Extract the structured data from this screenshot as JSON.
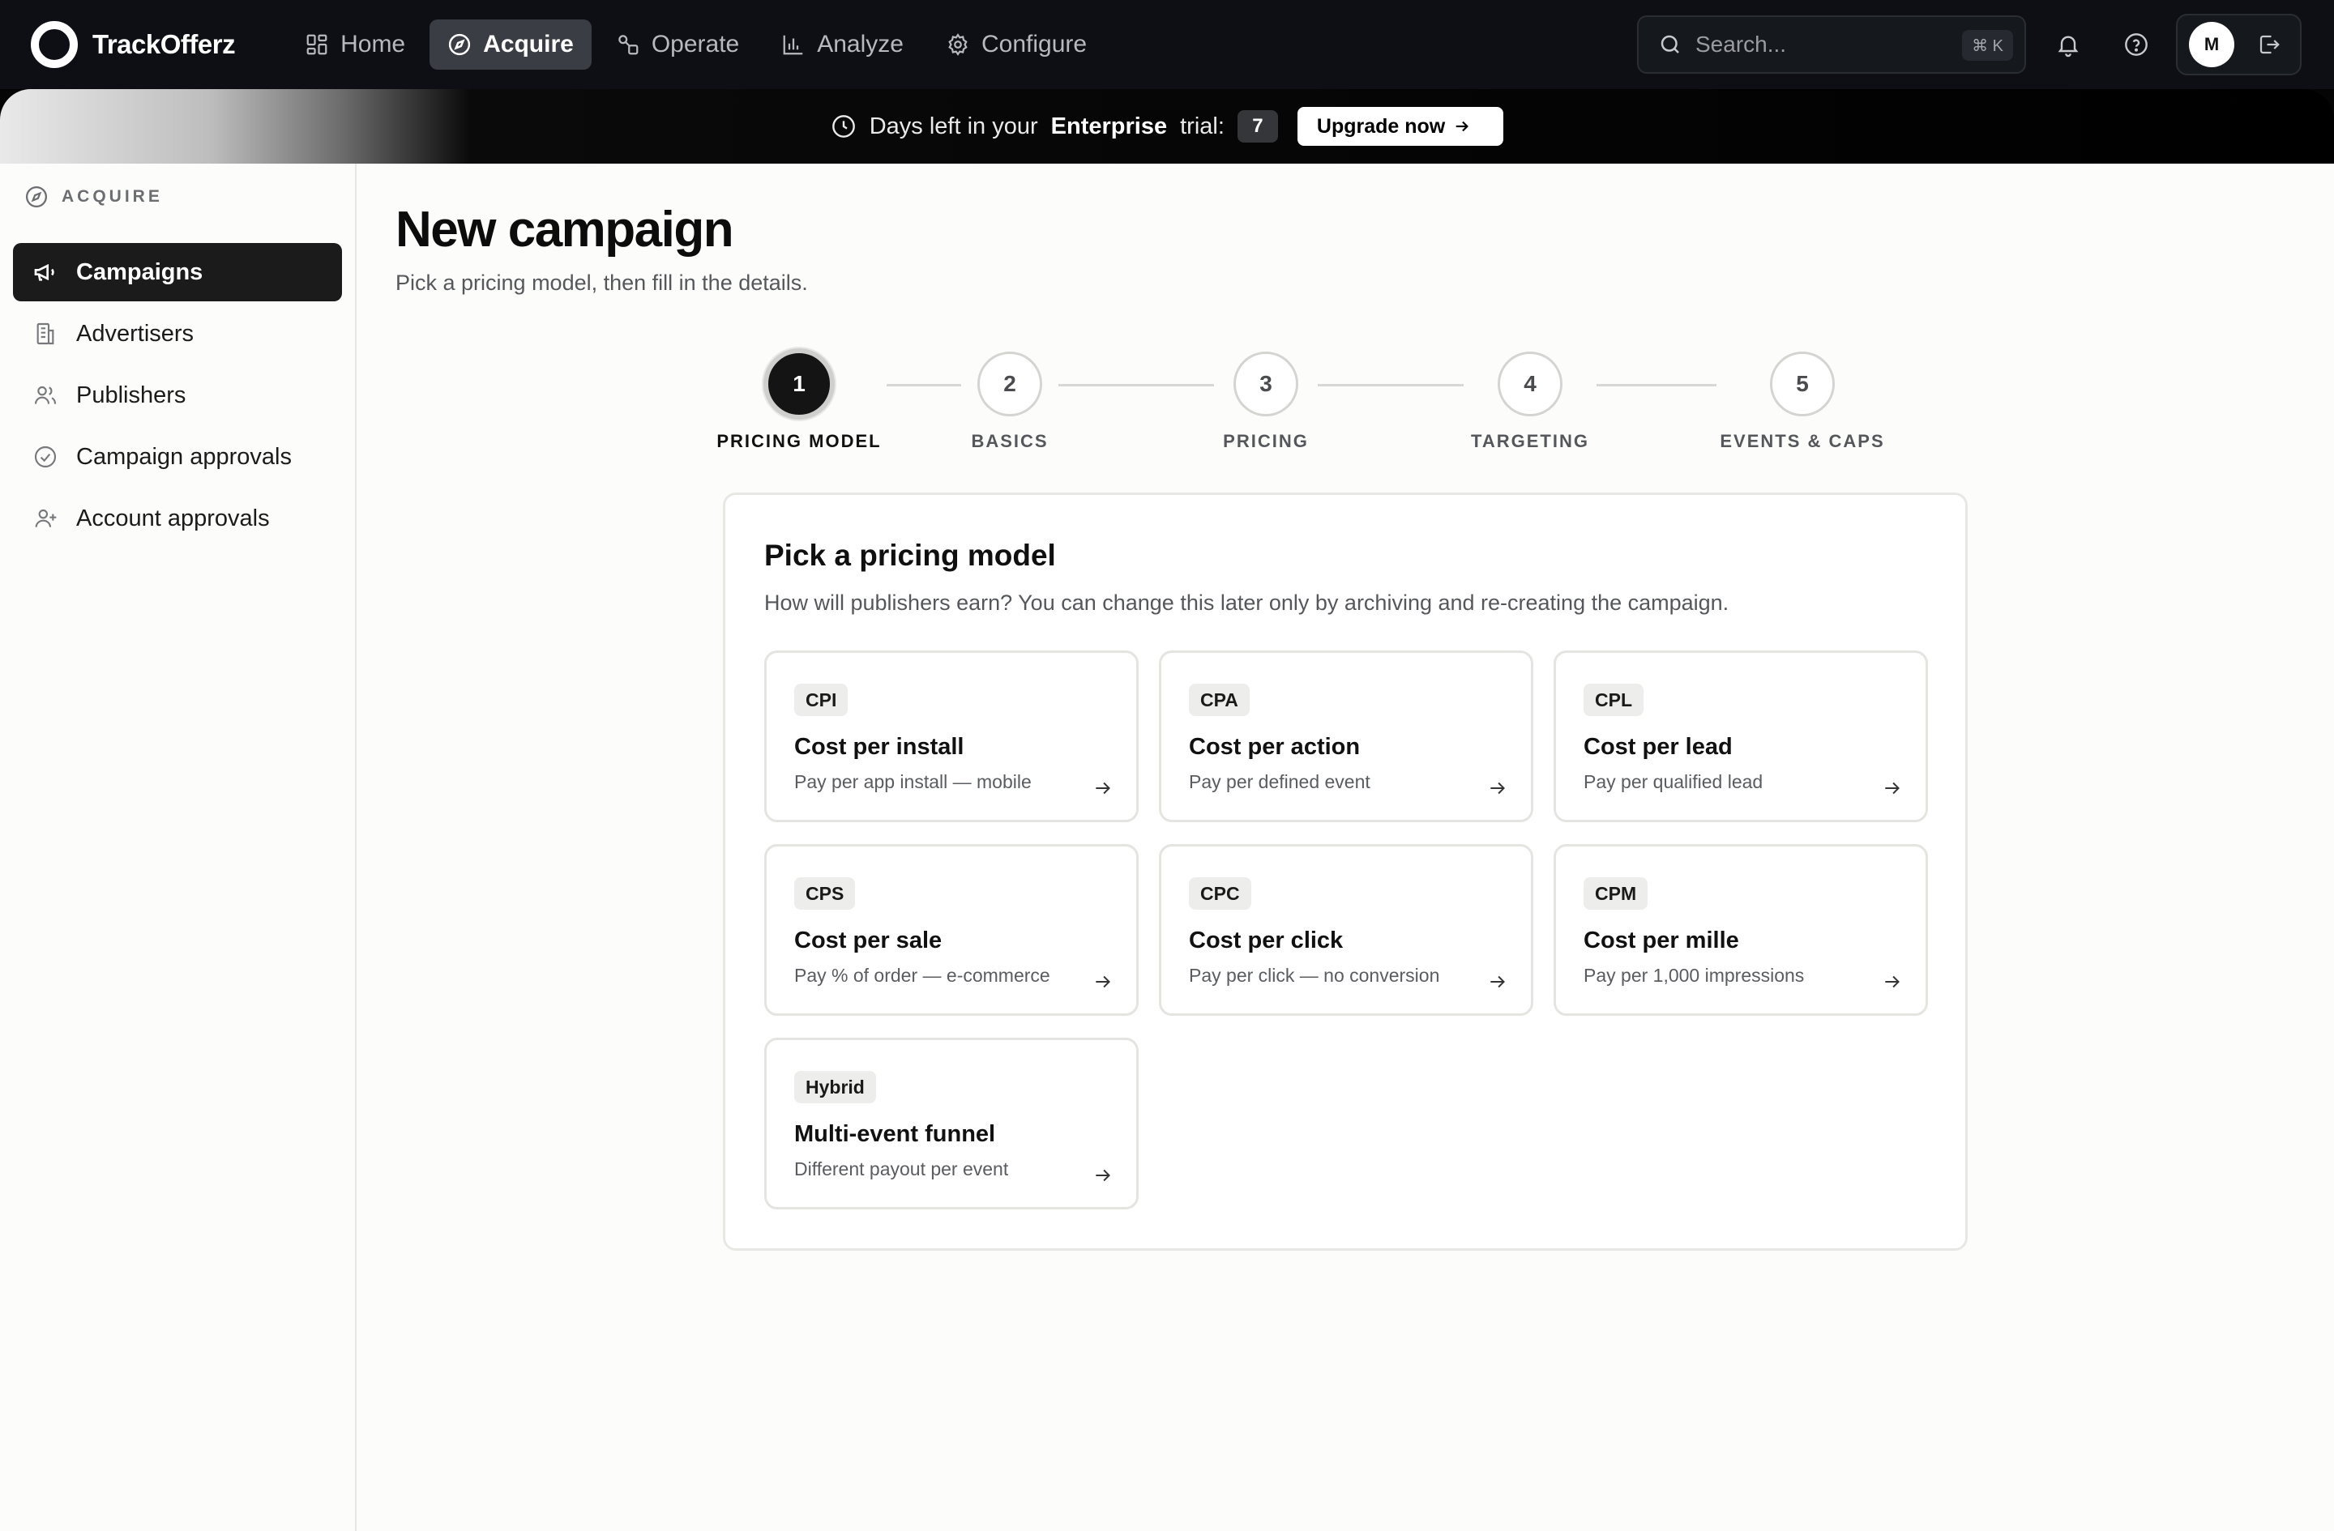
{
  "app": {
    "name": "TrackOfferz"
  },
  "nav": {
    "items": [
      {
        "label": "Home",
        "icon": "grid-icon"
      },
      {
        "label": "Acquire",
        "icon": "compass-icon",
        "active": true
      },
      {
        "label": "Operate",
        "icon": "shapes-icon"
      },
      {
        "label": "Analyze",
        "icon": "bar-chart-icon"
      },
      {
        "label": "Configure",
        "icon": "gear-icon"
      }
    ],
    "search_placeholder": "Search...",
    "search_shortcut": "⌘ K",
    "avatar_initial": "M"
  },
  "banner": {
    "prefix": "Days left in your",
    "plan": "Enterprise",
    "suffix": "trial:",
    "days": "7",
    "cta": "Upgrade now"
  },
  "sidebar": {
    "section": "ACQUIRE",
    "items": [
      {
        "label": "Campaigns",
        "icon": "megaphone-icon",
        "active": true
      },
      {
        "label": "Advertisers",
        "icon": "building-icon"
      },
      {
        "label": "Publishers",
        "icon": "users-icon"
      },
      {
        "label": "Campaign approvals",
        "icon": "check-circle-icon"
      },
      {
        "label": "Account approvals",
        "icon": "user-plus-icon"
      }
    ]
  },
  "page": {
    "title": "New campaign",
    "subtitle": "Pick a pricing model, then fill in the details."
  },
  "stepper": [
    {
      "number": "1",
      "label": "PRICING MODEL",
      "active": true
    },
    {
      "number": "2",
      "label": "BASICS"
    },
    {
      "number": "3",
      "label": "PRICING"
    },
    {
      "number": "4",
      "label": "TARGETING"
    },
    {
      "number": "5",
      "label": "EVENTS & CAPS"
    }
  ],
  "pricing": {
    "title": "Pick a pricing model",
    "subtitle": "How will publishers earn? You can change this later only by archiving and re-creating the campaign.",
    "options": [
      {
        "badge": "CPI",
        "title": "Cost per install",
        "desc": "Pay per app install — mobile"
      },
      {
        "badge": "CPA",
        "title": "Cost per action",
        "desc": "Pay per defined event"
      },
      {
        "badge": "CPL",
        "title": "Cost per lead",
        "desc": "Pay per qualified lead"
      },
      {
        "badge": "CPS",
        "title": "Cost per sale",
        "desc": "Pay % of order — e-commerce"
      },
      {
        "badge": "CPC",
        "title": "Cost per click",
        "desc": "Pay per click — no conversion"
      },
      {
        "badge": "CPM",
        "title": "Cost per mille",
        "desc": "Pay per 1,000 impressions"
      },
      {
        "badge": "Hybrid",
        "title": "Multi-event funnel",
        "desc": "Different payout per event"
      }
    ]
  }
}
